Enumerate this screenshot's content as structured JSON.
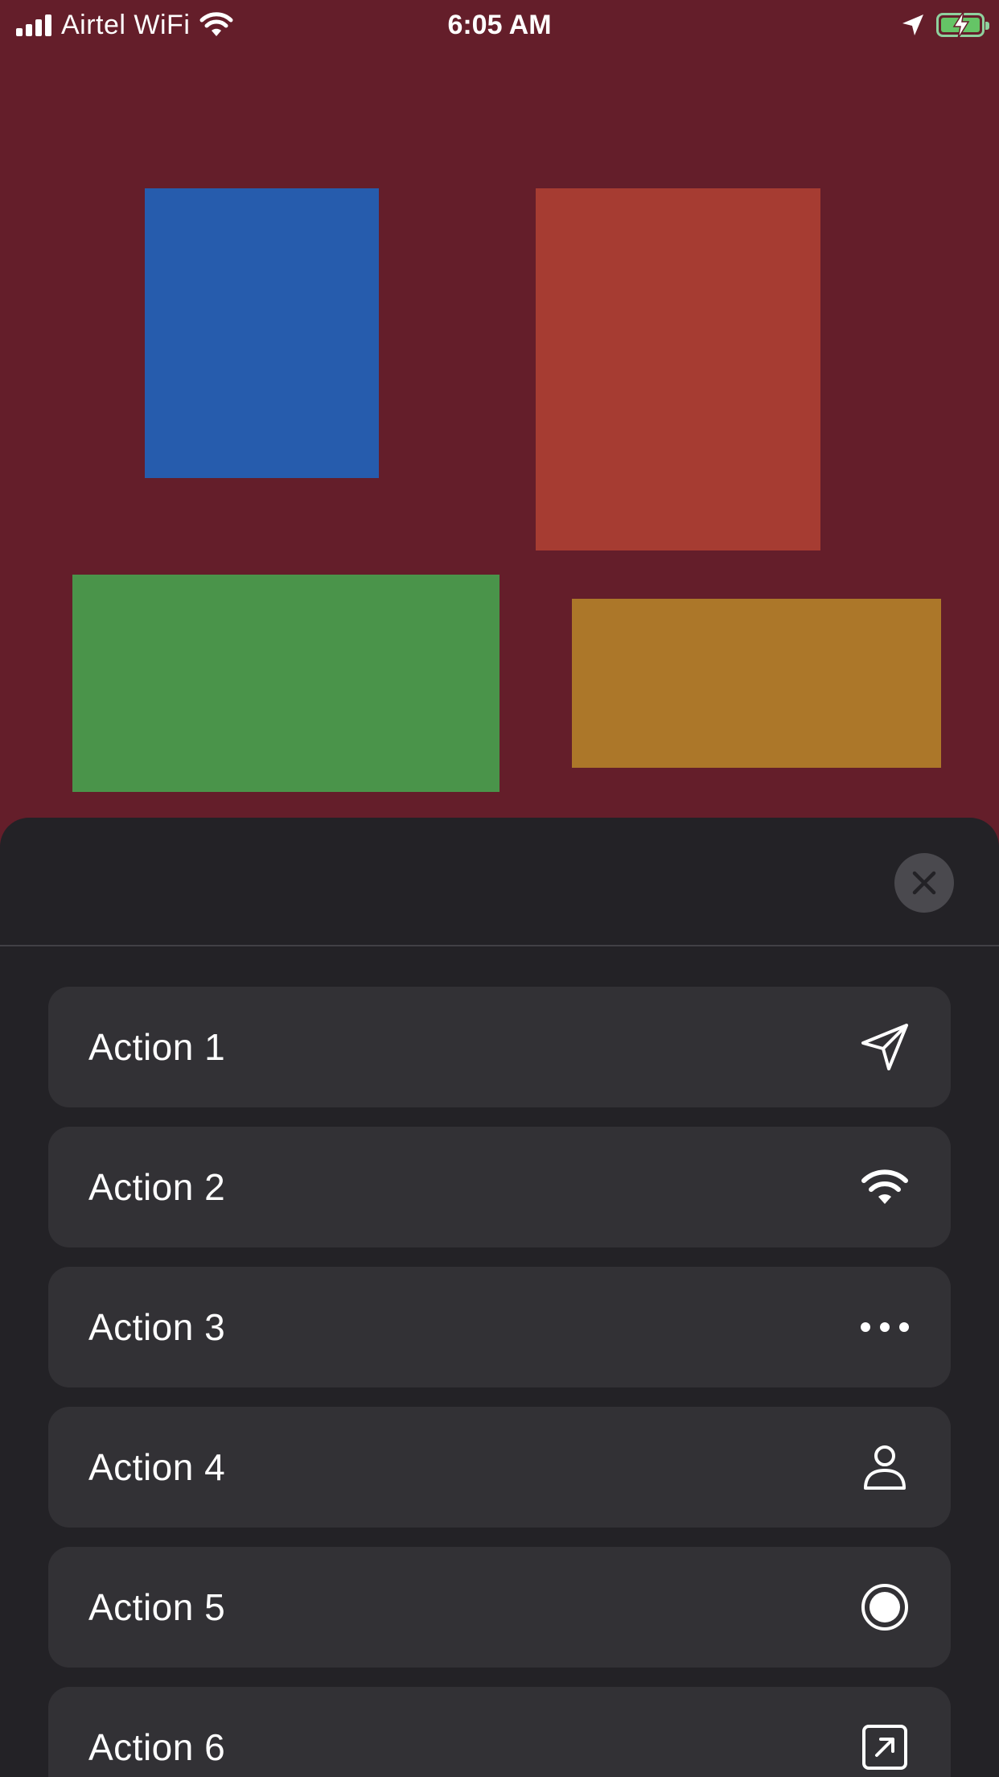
{
  "status_bar": {
    "carrier": "Airtel WiFi",
    "time": "6:05 AM",
    "icons": [
      "signal-bars-icon",
      "wifi-icon",
      "location-arrow-icon",
      "battery-charging-icon"
    ]
  },
  "canvas": {
    "rectangles": [
      {
        "name": "blue-rectangle",
        "color": "#265cad"
      },
      {
        "name": "red-rectangle",
        "color": "#a63c32"
      },
      {
        "name": "green-rectangle",
        "color": "#4a944a"
      },
      {
        "name": "orange-rectangle",
        "color": "#ac7729"
      }
    ]
  },
  "sheet": {
    "close_icon": "close-icon",
    "actions": [
      {
        "label": "Action 1",
        "icon": "paperplane-icon"
      },
      {
        "label": "Action 2",
        "icon": "wifi-icon"
      },
      {
        "label": "Action 3",
        "icon": "ellipsis-icon"
      },
      {
        "label": "Action 4",
        "icon": "person-icon"
      },
      {
        "label": "Action 5",
        "icon": "record-circle-icon"
      },
      {
        "label": "Action 6",
        "icon": "arrow-up-right-square-icon"
      }
    ]
  }
}
